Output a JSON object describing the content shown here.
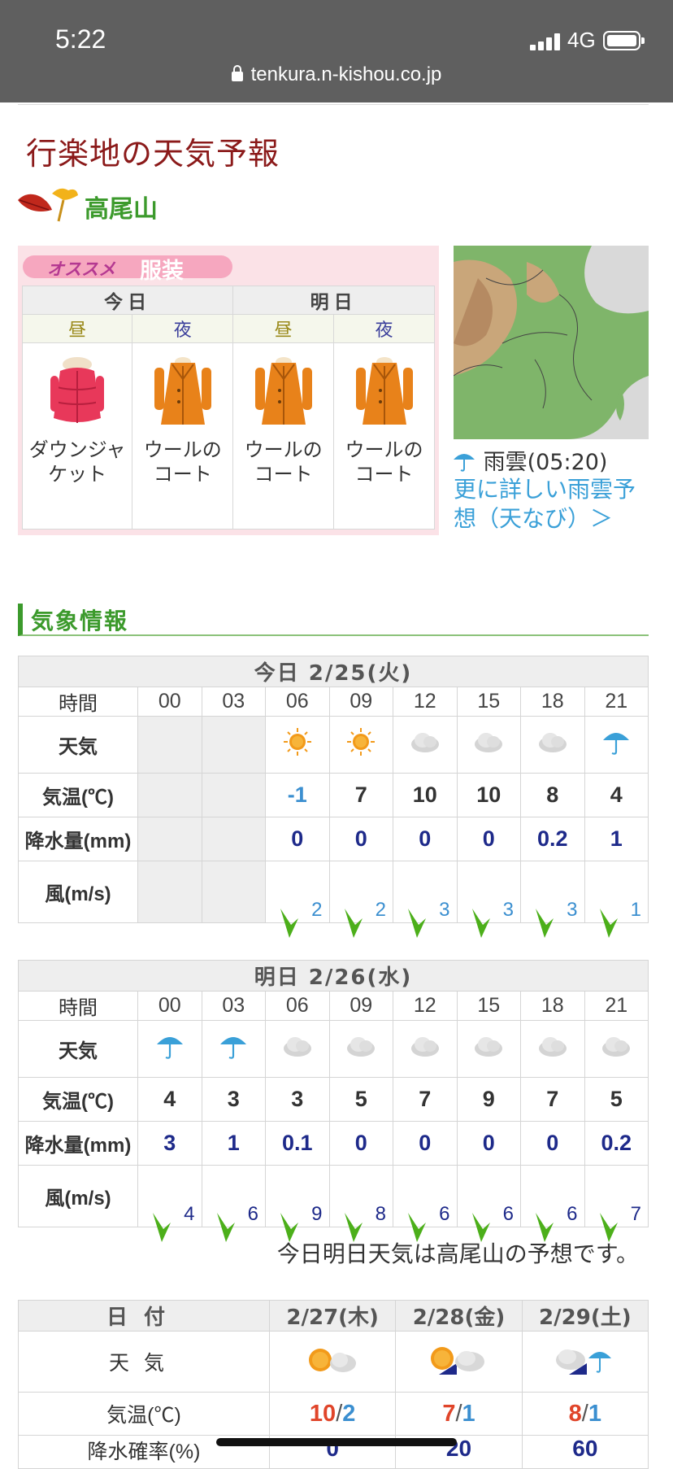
{
  "status_bar": {
    "time": "5:22",
    "network": "4G"
  },
  "url": "tenkura.n-kishou.co.jp",
  "page_title": "行楽地の天気予報",
  "location": "高尾山",
  "clothing": {
    "badge_a": "オススメ",
    "badge_b": "服装",
    "days": [
      "今日",
      "明日"
    ],
    "periods": [
      "昼",
      "夜",
      "昼",
      "夜"
    ],
    "items": [
      {
        "label": "ダウンジャケット",
        "icon": "down-jacket-icon"
      },
      {
        "label": "ウールのコート",
        "icon": "wool-coat-icon"
      },
      {
        "label": "ウールのコート",
        "icon": "wool-coat-icon"
      },
      {
        "label": "ウールのコート",
        "icon": "wool-coat-icon"
      }
    ]
  },
  "radar": {
    "caption": "雨雲(05:20)",
    "link": "更に詳しい雨雲予想（天なび）＞"
  },
  "section_title": "気象情報",
  "labels": {
    "time": "時間",
    "weather": "天気",
    "temp": "気温(℃)",
    "precip": "降水量(mm)",
    "wind": "風(m/s)"
  },
  "today": {
    "title": "今日 2/25(火)",
    "hours": [
      "00",
      "03",
      "06",
      "09",
      "12",
      "15",
      "18",
      "21"
    ],
    "weather": [
      "",
      "",
      "sun",
      "sun",
      "cloud",
      "cloud",
      "cloud",
      "umbrella"
    ],
    "temp": [
      "",
      "",
      "-1",
      "7",
      "10",
      "10",
      "8",
      "4"
    ],
    "precip": [
      "",
      "",
      "0",
      "0",
      "0",
      "0",
      "0.2",
      "1"
    ],
    "wind_speed": [
      "",
      "",
      "2",
      "2",
      "3",
      "3",
      "3",
      "1"
    ]
  },
  "tomorrow": {
    "title": "明日 2/26(水)",
    "hours": [
      "00",
      "03",
      "06",
      "09",
      "12",
      "15",
      "18",
      "21"
    ],
    "weather": [
      "umbrella",
      "umbrella",
      "cloud",
      "cloud",
      "cloud",
      "cloud",
      "cloud",
      "cloud"
    ],
    "temp": [
      "4",
      "3",
      "3",
      "5",
      "7",
      "9",
      "7",
      "5"
    ],
    "precip": [
      "3",
      "1",
      "0.1",
      "0",
      "0",
      "0",
      "0",
      "0.2"
    ],
    "wind_speed": [
      "4",
      "6",
      "9",
      "8",
      "6",
      "6",
      "6",
      "7"
    ]
  },
  "note": "今日明日天気は高尾山の予想です。",
  "weekly": {
    "date_label": "日付",
    "weather_label": "天気",
    "temp_label": "気温(℃)",
    "pop_label": "降水確率(%)",
    "days": [
      {
        "date": "2/27(木)",
        "weather": "sun-then-cloud",
        "hi": "10",
        "lo": "2",
        "pop": "0"
      },
      {
        "date": "2/28(金)",
        "weather": "sun-then-cloud",
        "hi": "7",
        "lo": "1",
        "pop": "20"
      },
      {
        "date": "2/29(土)",
        "weather": "cloud-then-rain",
        "hi": "8",
        "lo": "1",
        "pop": "60"
      }
    ]
  },
  "colors": {
    "title_red": "#8b1a1a",
    "green": "#3c9a2c",
    "link_blue": "#3aa0d8",
    "hi_red": "#e0452a",
    "lo_blue": "#3b8fd0"
  }
}
